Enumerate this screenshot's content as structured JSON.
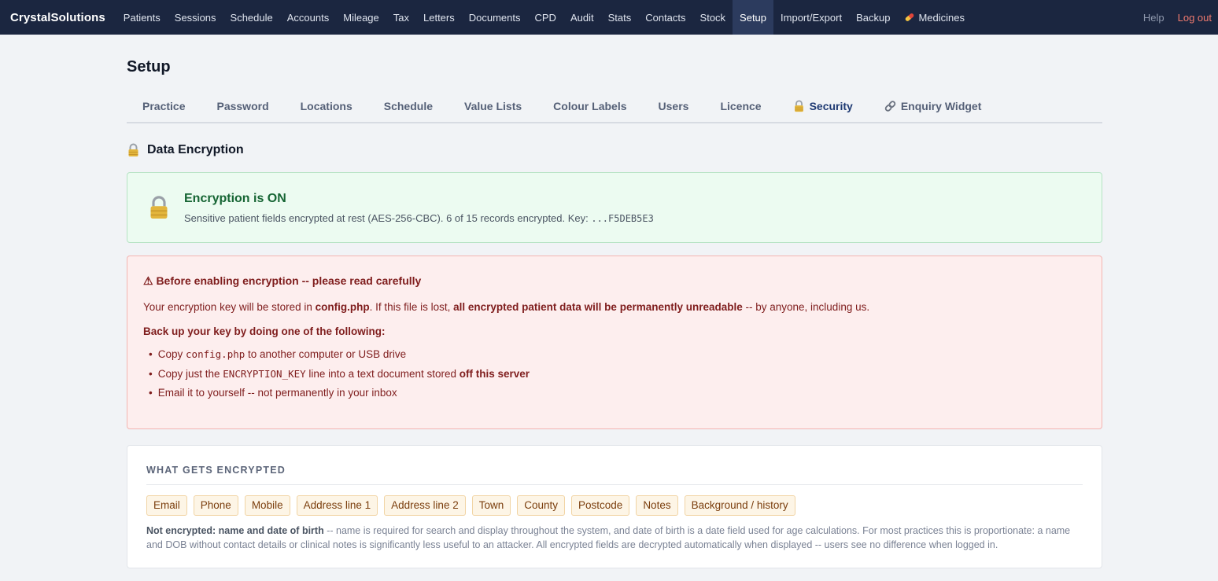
{
  "nav": {
    "brand": "CrystalSolutions",
    "items": [
      "Patients",
      "Sessions",
      "Schedule",
      "Accounts",
      "Mileage",
      "Tax",
      "Letters",
      "Documents",
      "CPD",
      "Audit",
      "Stats",
      "Contacts",
      "Stock",
      "Setup",
      "Import/Export",
      "Backup",
      "Medicines"
    ],
    "active_item": "Setup",
    "help": "Help",
    "logout": "Log out"
  },
  "page": {
    "title": "Setup",
    "tabs": [
      "Practice",
      "Password",
      "Locations",
      "Schedule",
      "Value Lists",
      "Colour Labels",
      "Users",
      "Licence",
      "Security",
      "Enquiry Widget"
    ],
    "active_tab": "Security"
  },
  "encryption": {
    "section_title": "Data Encryption",
    "status": {
      "title": "Encryption is ON",
      "text": "Sensitive patient fields encrypted at rest (AES-256-CBC). 6 of 15 records encrypted. Key: ",
      "key": "...F5DEB5E3"
    },
    "warning": {
      "title": "⚠ Before enabling encryption -- please read carefully",
      "p1_a": "Your encryption key will be stored in ",
      "p1_file": "config.php",
      "p1_b": ". If this file is lost, ",
      "p1_bold": "all encrypted patient data will be permanently unreadable",
      "p1_c": " -- by anyone, including us.",
      "subtitle": "Back up your key by doing one of the following:",
      "li1_a": "Copy ",
      "li1_code": "config.php",
      "li1_b": " to another computer or USB drive",
      "li2_a": "Copy just the ",
      "li2_code": "ENCRYPTION_KEY",
      "li2_b": " line into a text document stored ",
      "li2_bold": "off this server",
      "li3": "Email it to yourself -- not permanently in your inbox"
    },
    "what": {
      "title": "WHAT GETS ENCRYPTED",
      "fields": [
        "Email",
        "Phone",
        "Mobile",
        "Address line 1",
        "Address line 2",
        "Town",
        "County",
        "Postcode",
        "Notes",
        "Background / history"
      ],
      "note_bold": "Not encrypted: name and date of birth",
      "note": " -- name is required for search and display throughout the system, and date of birth is a date field used for age calculations. For most practices this is proportionate: a name and DOB without contact details or clinical notes is significantly less useful to an attacker. All encrypted fields are decrypted automatically when displayed -- users see no difference when logged in."
    }
  }
}
